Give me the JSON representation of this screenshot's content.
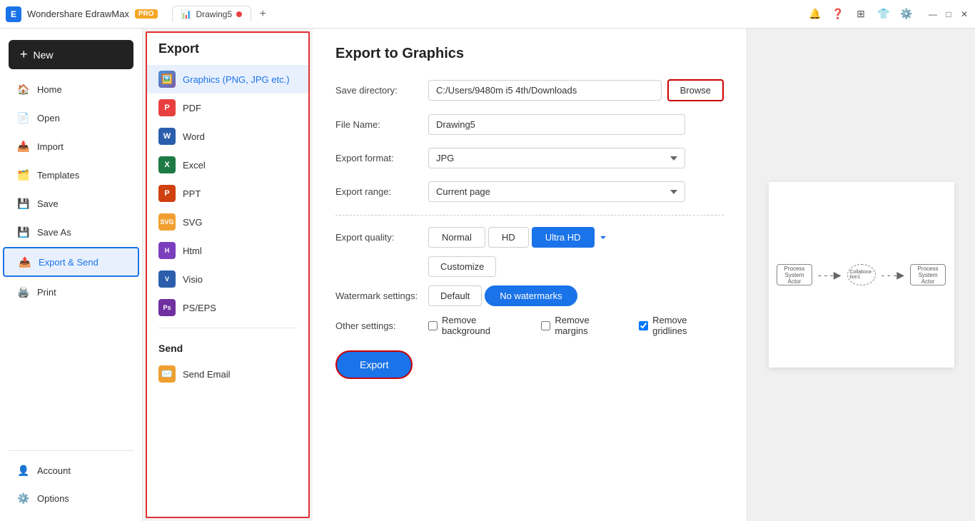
{
  "titlebar": {
    "app_name": "Wondershare EdrawMax",
    "pro_badge": "PRO",
    "tab_name": "Drawing5",
    "new_tab_icon": "+",
    "window_controls": {
      "minimize": "—",
      "maximize": "□",
      "close": "✕"
    }
  },
  "sidebar": {
    "new_button": "New",
    "items": [
      {
        "id": "home",
        "label": "Home",
        "icon": "🏠"
      },
      {
        "id": "open",
        "label": "Open",
        "icon": "📄"
      },
      {
        "id": "import",
        "label": "Import",
        "icon": "📥"
      },
      {
        "id": "templates",
        "label": "Templates",
        "icon": "🗂️"
      },
      {
        "id": "save",
        "label": "Save",
        "icon": "💾"
      },
      {
        "id": "save-as",
        "label": "Save As",
        "icon": "💾"
      },
      {
        "id": "export-send",
        "label": "Export & Send",
        "icon": "📤"
      },
      {
        "id": "print",
        "label": "Print",
        "icon": "🖨️"
      }
    ],
    "bottom_items": [
      {
        "id": "account",
        "label": "Account",
        "icon": "👤"
      },
      {
        "id": "options",
        "label": "Options",
        "icon": "⚙️"
      }
    ]
  },
  "export_panel": {
    "title": "Export",
    "export_items": [
      {
        "id": "graphics",
        "label": "Graphics (PNG, JPG etc.)",
        "icon": "🖼️",
        "active": true
      },
      {
        "id": "pdf",
        "label": "PDF",
        "icon": "📕"
      },
      {
        "id": "word",
        "label": "Word",
        "icon": "📘"
      },
      {
        "id": "excel",
        "label": "Excel",
        "icon": "📗"
      },
      {
        "id": "ppt",
        "label": "PPT",
        "icon": "📙"
      },
      {
        "id": "svg",
        "label": "SVG",
        "icon": "🔶"
      },
      {
        "id": "html",
        "label": "Html",
        "icon": "🌐"
      },
      {
        "id": "visio",
        "label": "Visio",
        "icon": "📘"
      },
      {
        "id": "pseps",
        "label": "PS/EPS",
        "icon": "🔷"
      }
    ],
    "send_section": "Send",
    "send_items": [
      {
        "id": "email",
        "label": "Send Email",
        "icon": "✉️"
      }
    ]
  },
  "export_settings": {
    "title": "Export to Graphics",
    "save_directory_label": "Save directory:",
    "save_directory_value": "C:/Users/9480m i5 4th/Downloads",
    "browse_btn": "Browse",
    "file_name_label": "File Name:",
    "file_name_value": "Drawing5",
    "export_format_label": "Export format:",
    "export_format_value": "JPG",
    "export_range_label": "Export range:",
    "export_range_value": "Current page",
    "export_quality_label": "Export quality:",
    "quality_options": [
      {
        "id": "normal",
        "label": "Normal",
        "active": false
      },
      {
        "id": "hd",
        "label": "HD",
        "active": false
      },
      {
        "id": "ultra-hd",
        "label": "Ultra HD",
        "active": true
      }
    ],
    "customize_btn": "Customize",
    "watermark_label": "Watermark settings:",
    "watermark_options": [
      {
        "id": "default",
        "label": "Default",
        "active": false
      },
      {
        "id": "no-watermarks",
        "label": "No watermarks",
        "active": true
      }
    ],
    "other_settings_label": "Other settings:",
    "other_settings": [
      {
        "id": "remove-bg",
        "label": "Remove background",
        "checked": false
      },
      {
        "id": "remove-margins",
        "label": "Remove margins",
        "checked": false
      },
      {
        "id": "remove-gridlines",
        "label": "Remove gridlines",
        "checked": true
      }
    ],
    "export_btn": "Export"
  },
  "preview": {
    "diagram_boxes": [
      {
        "text": "Process\nSystem Actor"
      },
      {
        "text": "----->",
        "is_arrow": true
      },
      {
        "text": "Collabora-\ntion1",
        "is_dashed": true
      },
      {
        "text": "Process\nSystem Actor"
      }
    ]
  }
}
